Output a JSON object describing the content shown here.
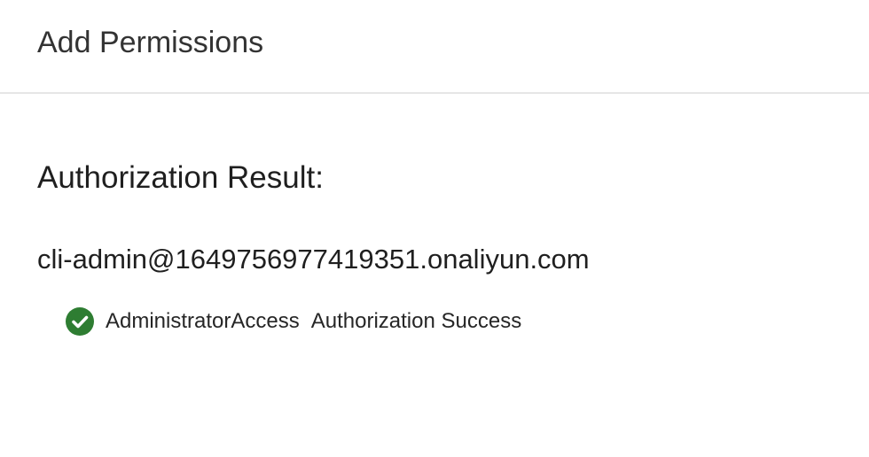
{
  "header": {
    "title": "Add Permissions"
  },
  "result": {
    "heading": "Authorization Result:",
    "account": "cli-admin@1649756977419351.onaliyun.com",
    "items": [
      {
        "policy": "AdministratorAccess",
        "status": "Authorization Success",
        "icon": "check-circle-icon",
        "status_color": "#2e7d32"
      }
    ]
  },
  "colors": {
    "success": "#2e7d32",
    "divider": "#e6e6e6",
    "text": "#262626"
  }
}
